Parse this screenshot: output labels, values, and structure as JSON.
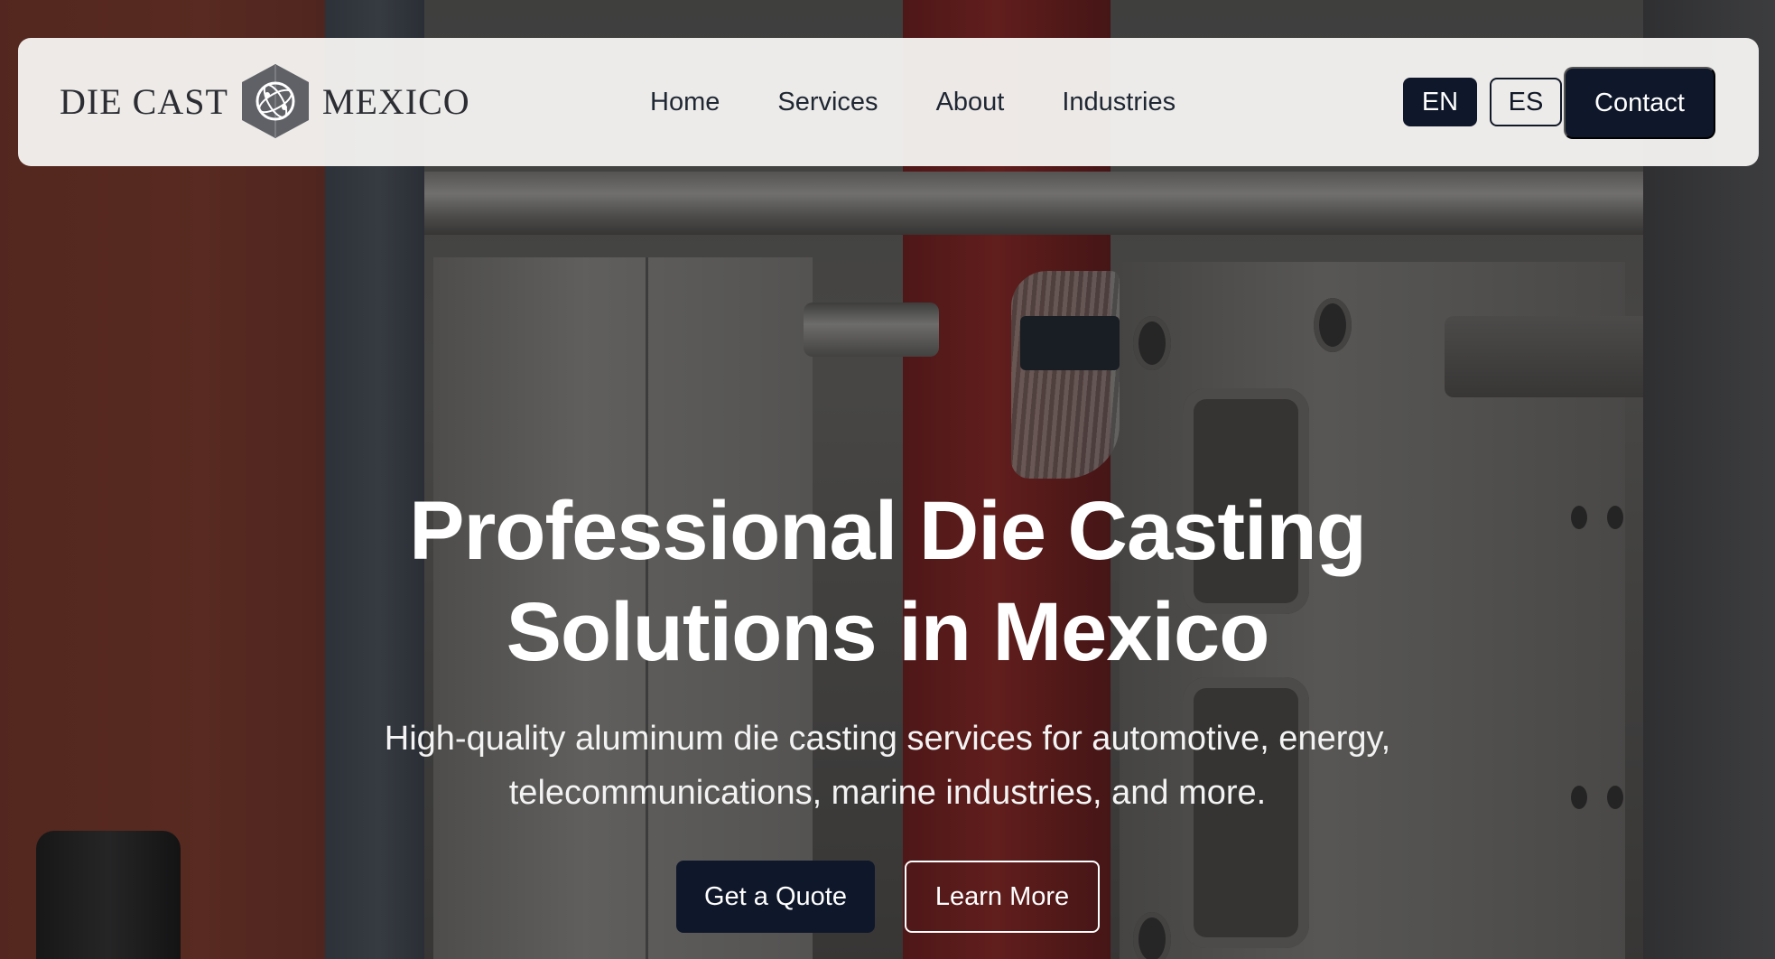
{
  "brand": {
    "logo_left": "DIE CAST",
    "logo_right": "MEXICO"
  },
  "nav": {
    "links": [
      "Home",
      "Services",
      "About",
      "Industries"
    ]
  },
  "language": {
    "en_label": "EN",
    "es_label": "ES",
    "active": "EN"
  },
  "contact_label": "Contact",
  "hero": {
    "title": "Professional Die Casting Solutions in Mexico",
    "subtitle": "High-quality aluminum die casting services for automotive, energy, telecommunications, marine industries, and more.",
    "primary_cta": "Get a Quote",
    "secondary_cta": "Learn More"
  },
  "colors": {
    "primary": "#0f172a",
    "navbar_bg": "#f5f4f2",
    "hero_text": "#ffffff"
  },
  "icons": {
    "logo_mark": "hexagon-globe-icon"
  }
}
